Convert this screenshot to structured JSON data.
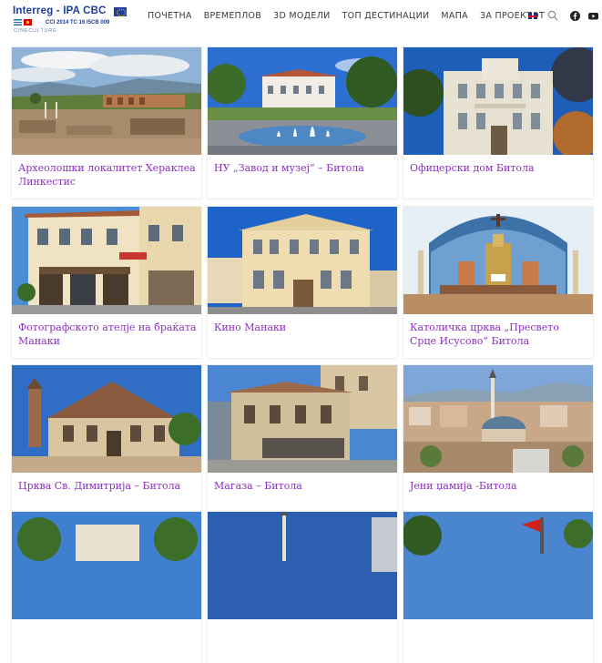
{
  "logo": {
    "title": "Interreg - IPA CBC",
    "code": "CCI 2014 TC 16 I5CB 009",
    "sub": "CINECULTURE"
  },
  "nav": {
    "items": [
      "ПОЧЕТНА",
      "ВРЕМЕПЛОВ",
      "3D МОДЕЛИ",
      "ТОП ДЕСТИНАЦИИ",
      "МАПА",
      "ЗА ПРОЕКТОТ"
    ]
  },
  "icons": {
    "language": "uk-flag-icon",
    "search": "search-icon",
    "facebook": "facebook-icon",
    "youtube": "youtube-icon"
  },
  "colors": {
    "title_link": "#8b2fc0",
    "logo_blue": "#1f3d99"
  },
  "cards": [
    {
      "title": "Археолошки локалитет Хераклеа Линкестис"
    },
    {
      "title": "НУ „Завод и музеј“ – Битола"
    },
    {
      "title": "Офицерски дом Битола"
    },
    {
      "title": "Фотографското ателје на браќата Манаки"
    },
    {
      "title": "Кино Манаки"
    },
    {
      "title": "Католичка црква „Пресвето Срце Исусово“ Битола"
    },
    {
      "title": "Црква Св. Димитрија – Битола"
    },
    {
      "title": "Магаза – Битола"
    },
    {
      "title": "Јени џамија -Битола"
    }
  ]
}
